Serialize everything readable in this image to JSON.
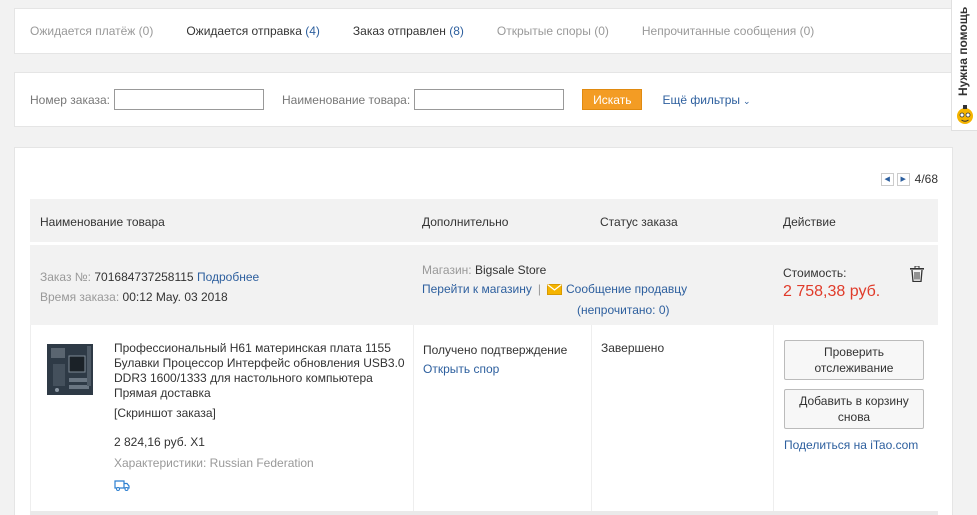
{
  "tabs": [
    {
      "label": "Ожидается платёж",
      "count": "(0)"
    },
    {
      "label": "Ожидается отправка",
      "count": "(4)"
    },
    {
      "label": "Заказ отправлен",
      "count": "(8)"
    },
    {
      "label": "Открытые споры",
      "count": "(0)"
    },
    {
      "label": "Непрочитанные сообщения",
      "count": "(0)"
    }
  ],
  "search": {
    "order_label": "Номер заказа:",
    "order_value": "",
    "product_label": "Наименование товара:",
    "product_value": "",
    "search_button": "Искать",
    "more_filters": "Ещё фильтры"
  },
  "pager": {
    "text": "4/68"
  },
  "table": {
    "col_name": "Наименование товара",
    "col_extra": "Дополнительно",
    "col_status": "Статус заказа",
    "col_action": "Действие"
  },
  "order": {
    "number_label": "Заказ №:",
    "number": "701684737258115",
    "details_link": "Подробнее",
    "time_label": "Время заказа:",
    "time": "00:12 May. 03 2018",
    "store_label": "Магазин:",
    "store_name": "Bigsale Store",
    "go_to_store": "Перейти к магазину",
    "message_seller": "Сообщение продавцу",
    "message_unread": "(непрочитано: 0)",
    "total_label": "Стоимость:",
    "total": "2 758,38 руб."
  },
  "item": {
    "title": "Профессиональный H61 материнская плата 1155 Булавки Процессор Интерфейс обновления USB3.0 DDR3 1600/1333 для настольного компьютера Прямая доставка",
    "screenshot": "[Скриншот заказа]",
    "price": "2 824,16 руб. X1",
    "spec_label": "Характеристики:",
    "spec_value": "Russian Federation",
    "extra_status": "Получено подтверждение",
    "open_dispute": "Открыть спор",
    "order_status": "Завершено",
    "track_button": "Проверить отслеживание",
    "add_cart_button": "Добавить в корзину снова",
    "share_prefix": "Поделиться на",
    "share_site": "iTao.com"
  },
  "help": {
    "label": "Нужна помощь"
  },
  "colors": {
    "accent": "#f39c24",
    "link": "#2d5f9e",
    "price": "#e03b2a"
  }
}
